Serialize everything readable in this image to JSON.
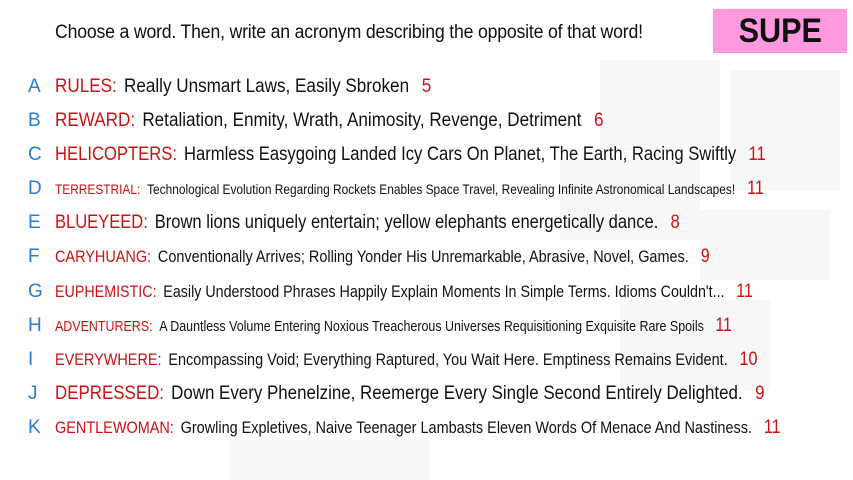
{
  "prompt": "Choose a word. Then, write an acronym describing the opposite of that word!",
  "badge": "SUPE",
  "colors": {
    "letter": "#2a7ad8",
    "word": "#cc1111",
    "badge_bg": "#ff99dd"
  },
  "rows": [
    {
      "letter": "A",
      "word": "RULES",
      "acronym": "Really Unsmart Laws, Easily Sbroken",
      "count": "5"
    },
    {
      "letter": "B",
      "word": "REWARD",
      "acronym": "Retaliation, Enmity, Wrath, Animosity, Revenge, Detriment",
      "count": "6"
    },
    {
      "letter": "C",
      "word": "HELICOPTERS",
      "acronym": "Harmless Easygoing Landed Icy Cars On Planet, The Earth, Racing Swiftly",
      "count": "11"
    },
    {
      "letter": "D",
      "word": "TERRESTRIAL",
      "acronym": "Technological Evolution Regarding Rockets Enables Space Travel, Revealing Infinite Astronomical Landscapes!",
      "count": "11"
    },
    {
      "letter": "E",
      "word": "BLUEYEED",
      "acronym": "Brown lions uniquely entertain; yellow elephants energetically dance.",
      "count": "8"
    },
    {
      "letter": "F",
      "word": "CARYHUANG",
      "acronym": "Conventionally Arrives; Rolling Yonder His Unremarkable, Abrasive, Novel, Games.",
      "count": "9"
    },
    {
      "letter": "G",
      "word": "EUPHEMISTIC",
      "acronym": "Easily Understood Phrases Happily Explain Moments In Simple Terms. Idioms Couldn't...",
      "count": "11"
    },
    {
      "letter": "H",
      "word": "ADVENTURERS",
      "acronym": "A Dauntless Volume Entering Noxious Treacherous Universes Requisitioning Exquisite Rare Spoils",
      "count": "11"
    },
    {
      "letter": "I",
      "word": "EVERYWHERE",
      "acronym": "Encompassing Void; Everything Raptured, You Wait Here. Emptiness Remains Evident.",
      "count": "10"
    },
    {
      "letter": "J",
      "word": "DEPRESSED",
      "acronym": "Down Every Phenelzine, Reemerge Every Single Second Entirely Delighted.",
      "count": "9"
    },
    {
      "letter": "K",
      "word": "GENTLEWOMAN",
      "acronym": "Growling Expletives, Naive Teenager Lambasts Eleven Words Of Menace And Nastiness.",
      "count": "11"
    }
  ]
}
